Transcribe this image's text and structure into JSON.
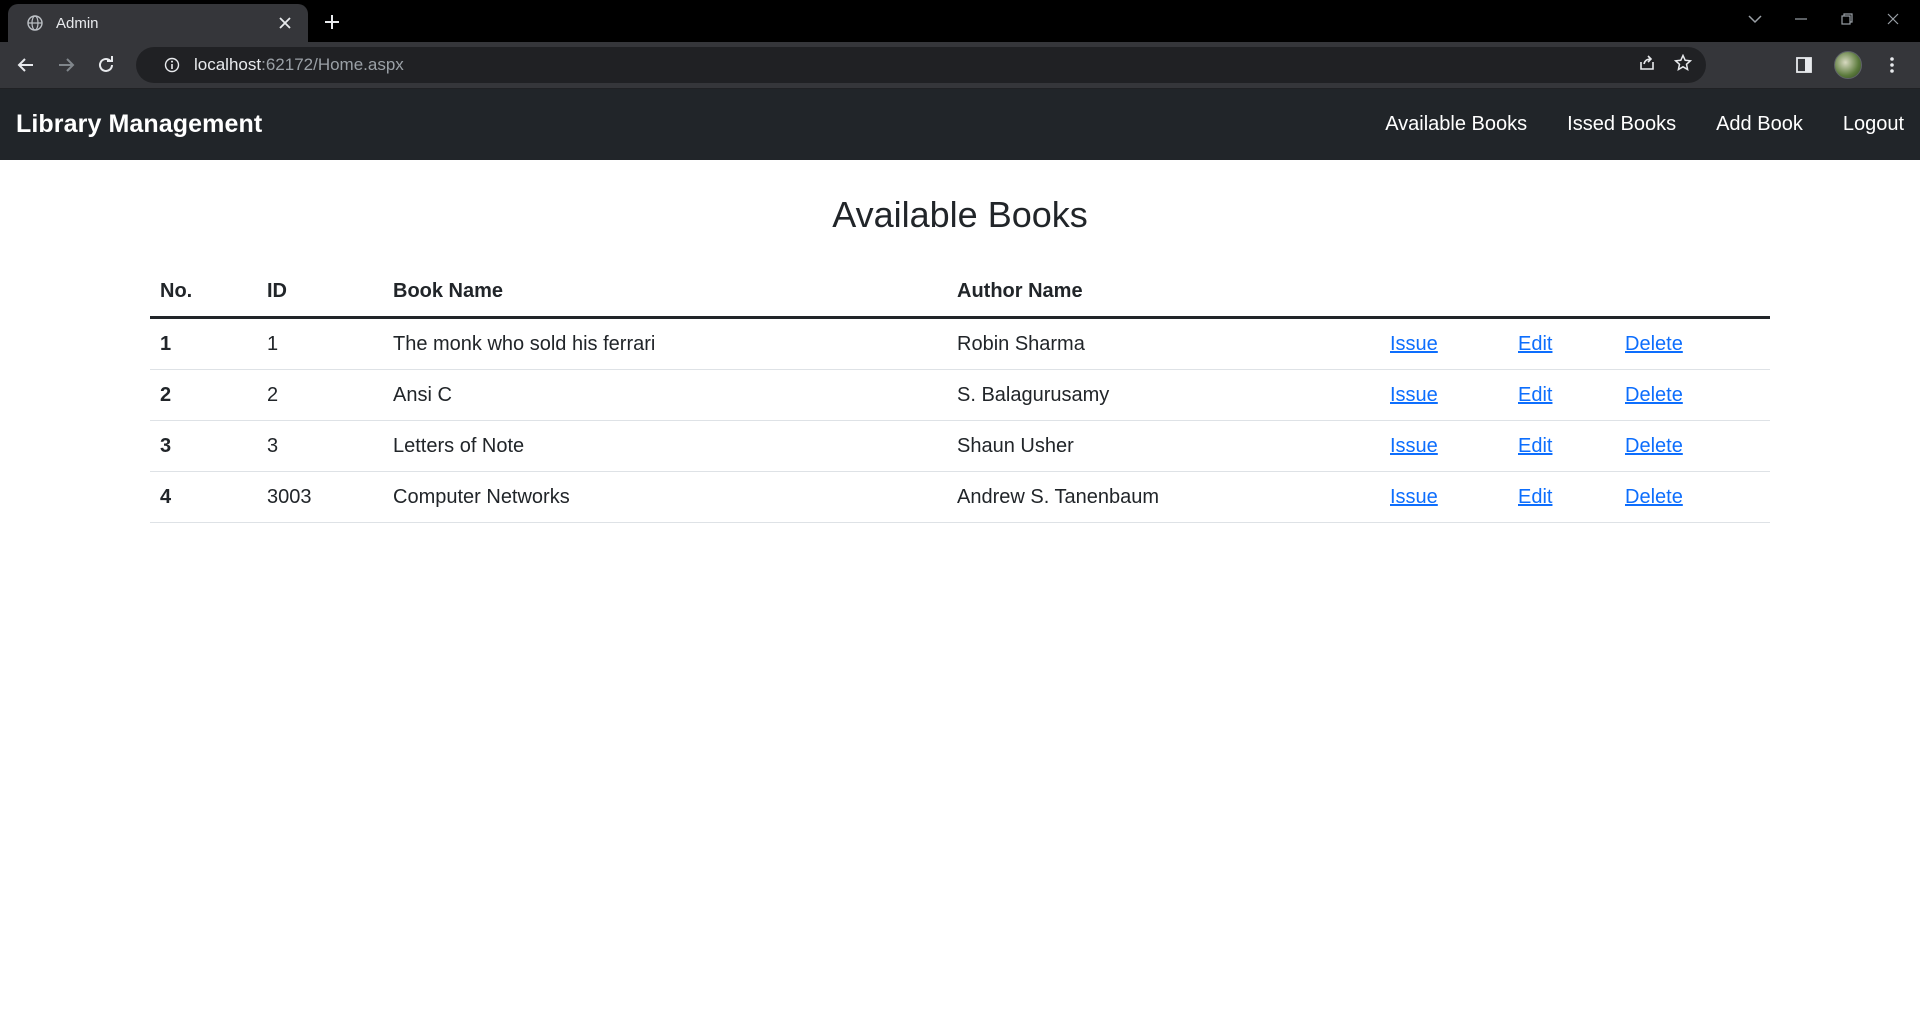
{
  "browser": {
    "tab_title": "Admin",
    "url_host": "localhost",
    "url_rest": ":62172/Home.aspx"
  },
  "navbar": {
    "brand": "Library Management",
    "links": [
      "Available Books",
      "Issed Books",
      "Add Book",
      "Logout"
    ]
  },
  "page": {
    "title": "Available Books"
  },
  "table": {
    "headers": [
      "No.",
      "ID",
      "Book Name",
      "Author Name"
    ],
    "actions": [
      "Issue",
      "Edit",
      "Delete"
    ],
    "rows": [
      {
        "no": "1",
        "id": "1",
        "book": "The monk who sold his ferrari",
        "author": "Robin Sharma"
      },
      {
        "no": "2",
        "id": "2",
        "book": "Ansi C",
        "author": "S. Balagurusamy"
      },
      {
        "no": "3",
        "id": "3",
        "book": "Letters of Note",
        "author": "Shaun Usher"
      },
      {
        "no": "4",
        "id": "3003",
        "book": "Computer Networks",
        "author": "Andrew S. Tanenbaum"
      }
    ]
  },
  "colors": {
    "navbar_bg": "#212529",
    "link": "#0d6efd",
    "browser_toolbar": "#35363a"
  }
}
